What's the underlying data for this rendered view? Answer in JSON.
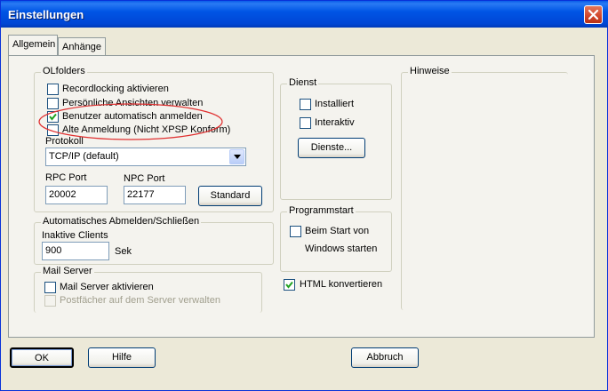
{
  "window": {
    "title": "Einstellungen"
  },
  "tabs": [
    {
      "label": "Allgemein"
    },
    {
      "label": "Anhänge"
    }
  ],
  "olfolders": {
    "legend": "OLfolders",
    "recordlocking": {
      "label": "Recordlocking aktivieren",
      "checked": false
    },
    "persoenliche": {
      "label": "Persönliche Ansichten verwalten",
      "checked": false
    },
    "benutzer": {
      "label": "Benutzer automatisch anmelden",
      "checked": true
    },
    "alte": {
      "label": "Alte Anmeldung (Nicht XPSP Konform)",
      "checked": false
    },
    "protokoll_label": "Protokoll",
    "protokoll_value": "TCP/IP (default)",
    "rpc_label": "RPC Port",
    "rpc_value": "20002",
    "npc_label": "NPC Port",
    "npc_value": "22177",
    "standard_button": "Standard"
  },
  "abmelden": {
    "legend": "Automatisches Abmelden/Schließen",
    "inaktive_label": "Inaktive Clients",
    "inaktive_value": "900",
    "unit": "Sek"
  },
  "mailserver": {
    "legend": "Mail Server",
    "aktivieren": {
      "label": "Mail Server aktivieren",
      "checked": false
    },
    "postfaecher": {
      "label": "Postfächer auf dem Server verwalten",
      "checked": false,
      "disabled": true
    }
  },
  "dienst": {
    "legend": "Dienst",
    "installiert": {
      "label": "Installiert",
      "checked": false
    },
    "interaktiv": {
      "label": "Interaktiv",
      "checked": false
    },
    "dienste_button": "Dienste..."
  },
  "programmstart": {
    "legend": "Programmstart",
    "beim_start_line1": "Beim Start von",
    "beim_start_line2": "Windows starten",
    "checked": false
  },
  "html_konvertieren": {
    "label": "HTML konvertieren",
    "checked": true
  },
  "hinweise": {
    "legend": "Hinweise"
  },
  "buttons": {
    "ok": "OK",
    "hilfe": "Hilfe",
    "abbruch": "Abbruch"
  },
  "colors": {
    "title_bar": "#0055E5",
    "annotation_circle": "#E03030",
    "dialog_bg": "#ECE9D8"
  },
  "icons": {
    "close": "close-icon",
    "dropdown": "chevron-down-icon",
    "check": "checkmark-icon"
  }
}
